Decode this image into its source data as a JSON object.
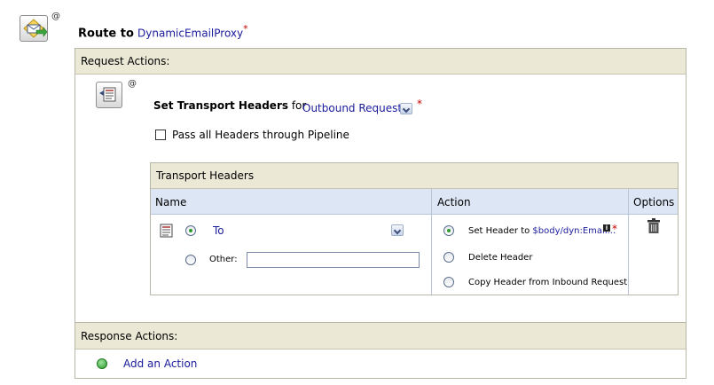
{
  "route": {
    "prefix": "Route to",
    "service": "DynamicEmailProxy",
    "required_mark": "*",
    "annotation_mark": "@",
    "icon": "route-envelope-icon"
  },
  "request_actions": {
    "header": "Request Actions:",
    "set_headers": {
      "title": "Set Transport Headers",
      "for_text": "for",
      "target_value": "Outbound Request",
      "required_mark": "*",
      "annotation_mark": "@",
      "icon": "transport-headers-icon",
      "pass_all_label": "Pass all Headers through Pipeline",
      "pass_all_checked": false
    },
    "table": {
      "caption": "Transport Headers",
      "columns": [
        "Name",
        "Action",
        "Options"
      ],
      "name_options": {
        "selected_header": "To",
        "other_label": "Other:",
        "other_value": ""
      },
      "action_options": {
        "set_header_prefix": "Set Header to",
        "set_header_expr": "$body/dyn:Email...",
        "set_header_required": "*",
        "delete_label": "Delete Header",
        "copy_label": "Copy Header from Inbound Request",
        "selected": "set"
      },
      "options_icon": "trash-icon"
    }
  },
  "response_actions": {
    "header": "Response Actions:",
    "add_action_label": "Add an Action",
    "add_icon": "green-plus-icon"
  }
}
